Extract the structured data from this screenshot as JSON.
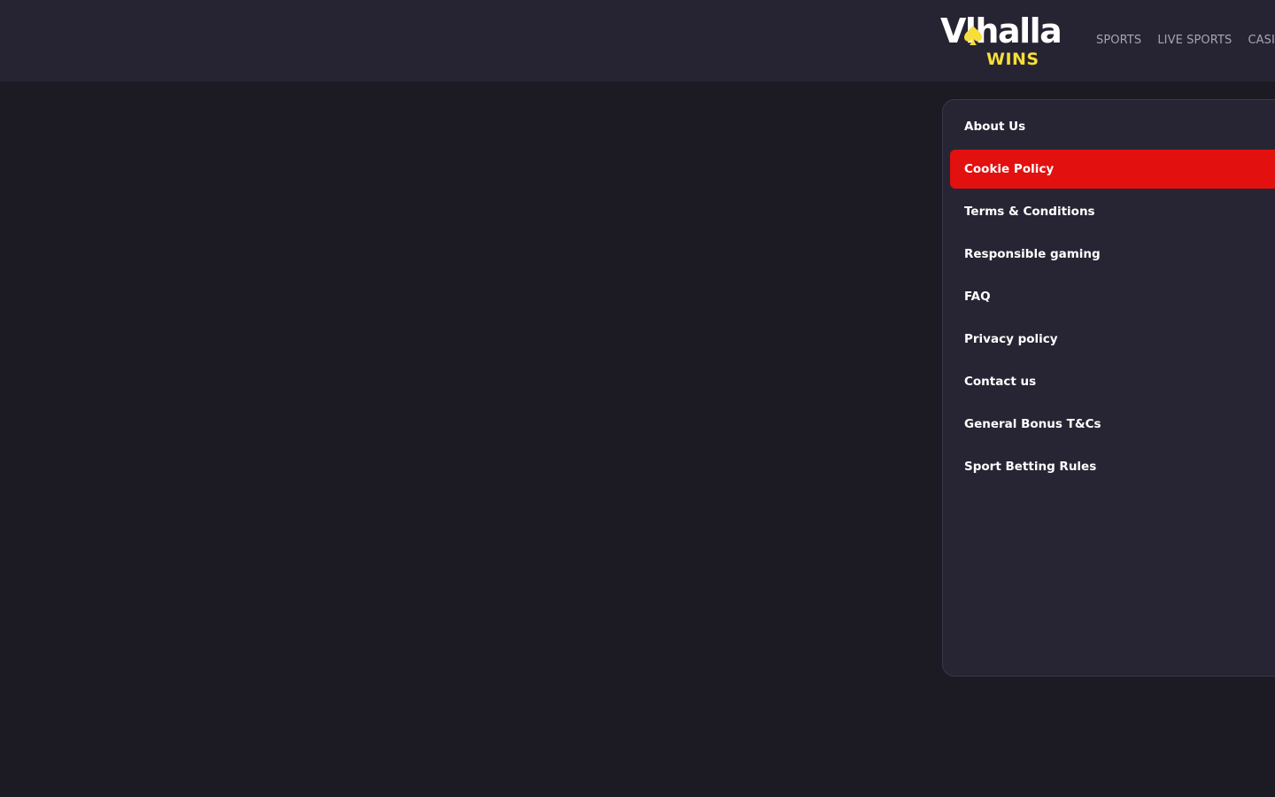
{
  "logo": {
    "word": "Vlhalla",
    "sub": "WINS",
    "spade_icon": "spade-icon",
    "spade_color": "#f7de3a"
  },
  "nav": {
    "items": [
      "SPORTS",
      "LIVE SPORTS",
      "CASINO"
    ]
  },
  "menu": {
    "items": [
      {
        "label": "About Us"
      },
      {
        "label": "Cookie Policy",
        "active": true
      },
      {
        "label": "Terms & Conditions"
      },
      {
        "label": "Responsible gaming"
      },
      {
        "label": "FAQ"
      },
      {
        "label": "Privacy policy"
      },
      {
        "label": "Contact us"
      },
      {
        "label": "General Bonus T&Cs"
      },
      {
        "label": "Sport Betting Rules"
      }
    ]
  },
  "colors": {
    "background": "#1c1b24",
    "header": "#262432",
    "panel": "#272533",
    "active": "#e2100f",
    "accent": "#f7de3a"
  }
}
